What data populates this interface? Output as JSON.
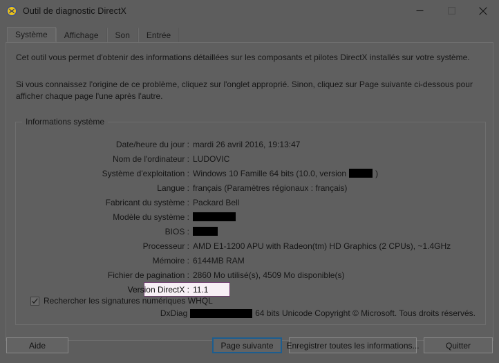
{
  "window": {
    "title": "Outil de diagnostic DirectX",
    "icon": "directx-diagnostic-icon",
    "controls": {
      "minimize": "minimize-icon",
      "maximize": "maximize-icon",
      "close": "close-icon"
    }
  },
  "tabs": [
    {
      "label": "Système",
      "active": true
    },
    {
      "label": "Affichage",
      "active": false
    },
    {
      "label": "Son",
      "active": false
    },
    {
      "label": "Entrée",
      "active": false
    }
  ],
  "intro": {
    "paragraph1": "Cet outil vous permet d'obtenir des informations détaillées sur les composants et pilotes DirectX installés sur votre système.",
    "paragraph2": "Si vous connaissez l'origine de ce problème, cliquez sur l'onglet approprié. Sinon, cliquez sur Page suivante ci-dessous pour afficher chaque page l'une après l'autre."
  },
  "group": {
    "legend": "Informations système",
    "rows": [
      {
        "label": "Date/heure du jour :",
        "value": "mardi 26 avril 2016, 19:13:47"
      },
      {
        "label": "Nom de l'ordinateur :",
        "value": "LUDOVIC"
      },
      {
        "label": "Système d'exploitation :",
        "value_prefix": "Windows 10 Famille 64 bits (10.0, version",
        "redacted_width": 34,
        "value_suffix": ")"
      },
      {
        "label": "Langue :",
        "value": "français (Paramètres régionaux : français)"
      },
      {
        "label": "Fabricant du système :",
        "value": "Packard Bell"
      },
      {
        "label": "Modèle du système :",
        "value": "",
        "redacted_width": 62
      },
      {
        "label": "BIOS :",
        "value": "",
        "redacted_width": 36
      },
      {
        "label": "Processeur :",
        "value": "AMD E1-1200 APU with Radeon(tm) HD Graphics (2 CPUs), ~1.4GHz"
      },
      {
        "label": "Mémoire :",
        "value": "6144MB RAM"
      },
      {
        "label": "Fichier de pagination :",
        "value": "2860 Mo utilisé(s), 4509 Mo disponible(s)"
      },
      {
        "label": "Version DirectX :",
        "value": "11.1",
        "highlight": true
      }
    ]
  },
  "checkbox": {
    "label": "Rechercher les signatures numériques WHQL",
    "checked": true
  },
  "dxfooter": {
    "prefix": "DxDiag",
    "redacted_width": 90,
    "suffix": "64 bits Unicode Copyright © Microsoft. Tous droits réservés."
  },
  "buttons": {
    "help": "Aide",
    "next": "Page suivante",
    "save": "Enregistrer toutes les informations...",
    "quit": "Quitter"
  },
  "colors": {
    "window_bg": "#5d5d5d",
    "page_bg": "#5f5f5f",
    "highlight_border": "#6b3a6b",
    "highlight_fill": "#f7eff5",
    "default_button_border": "#1c5d8f",
    "redaction": "#000000"
  }
}
